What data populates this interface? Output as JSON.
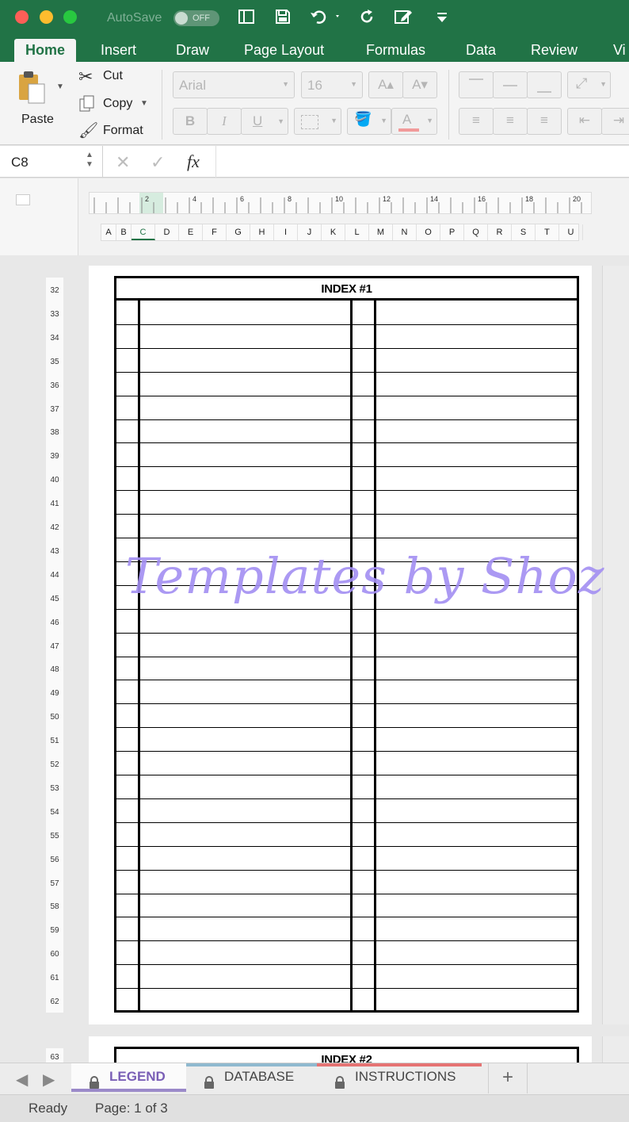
{
  "titlebar": {
    "autosave_label": "AutoSave",
    "autosave_state": "OFF"
  },
  "tabs": [
    {
      "label": "Home",
      "active": true
    },
    {
      "label": "Insert"
    },
    {
      "label": "Draw"
    },
    {
      "label": "Page Layout"
    },
    {
      "label": "Formulas"
    },
    {
      "label": "Data"
    },
    {
      "label": "Review"
    },
    {
      "label": "Vi"
    }
  ],
  "ribbon": {
    "paste_label": "Paste",
    "cut_label": "Cut",
    "copy_label": "Copy",
    "format_label": "Format",
    "font_name": "Arial",
    "font_size": "16",
    "bold": "B",
    "italic": "I",
    "underline": "U",
    "font_color_letter": "A"
  },
  "formula_bar": {
    "cell_ref": "C8",
    "fx": "fx",
    "value": ""
  },
  "ruler": {
    "labels": [
      "2",
      "4",
      "6",
      "8",
      "10",
      "12",
      "14",
      "16",
      "18",
      "20"
    ]
  },
  "columns": [
    "A",
    "B",
    "C",
    "D",
    "E",
    "F",
    "G",
    "H",
    "I",
    "J",
    "K",
    "L",
    "M",
    "N",
    "O",
    "P",
    "Q",
    "R",
    "S",
    "T",
    "U"
  ],
  "selected_column": "C",
  "rows": [
    "32",
    "33",
    "34",
    "35",
    "36",
    "37",
    "38",
    "39",
    "40",
    "41",
    "42",
    "43",
    "44",
    "45",
    "46",
    "47",
    "48",
    "49",
    "50",
    "51",
    "52",
    "53",
    "54",
    "55",
    "56",
    "57",
    "58",
    "59",
    "60",
    "61",
    "62"
  ],
  "next_row": "63",
  "index1_title": "INDEX #1",
  "index2_title": "INDEX #2",
  "watermark": "Templates by Shoz",
  "sheet_tabs": [
    {
      "label": "LEGEND",
      "active": true,
      "color": "#9b8ac9"
    },
    {
      "label": "DATABASE",
      "color": "#8fb9cf"
    },
    {
      "label": "INSTRUCTIONS",
      "color": "#e57373"
    }
  ],
  "add_sheet": "+",
  "status": {
    "ready": "Ready",
    "page": "Page: 1 of 3"
  },
  "colors": {
    "excel_green": "#217346",
    "watermark": "#a38ff2"
  }
}
